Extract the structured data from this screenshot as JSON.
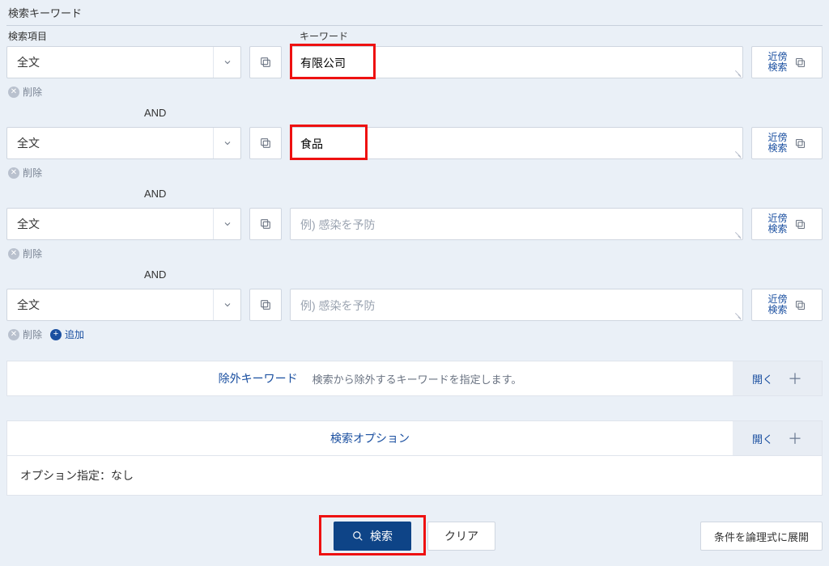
{
  "section_title": "検索キーワード",
  "labels": {
    "item": "検索項目",
    "keyword": "キーワード"
  },
  "operator": "AND",
  "placeholder": "例) 感染を予防",
  "select_label": "全文",
  "proximity_label": "近傍\n検索",
  "remove_label": "削除",
  "add_label": "追加",
  "rows": [
    {
      "value": "有限公司",
      "highlight": true
    },
    {
      "value": "食品",
      "highlight": true
    },
    {
      "value": "",
      "highlight": false
    },
    {
      "value": "",
      "highlight": false
    }
  ],
  "exclude_panel": {
    "link": "除外キーワード",
    "desc": "検索から除外するキーワードを指定します。",
    "toggle": "開く"
  },
  "options_panel": {
    "title": "検索オプション",
    "toggle": "開く",
    "body": "オプション指定：なし"
  },
  "buttons": {
    "search": "検索",
    "clear": "クリア",
    "expand": "条件を論理式に展開"
  },
  "highlight_widths": {
    "w1": 106,
    "w2": 96
  }
}
